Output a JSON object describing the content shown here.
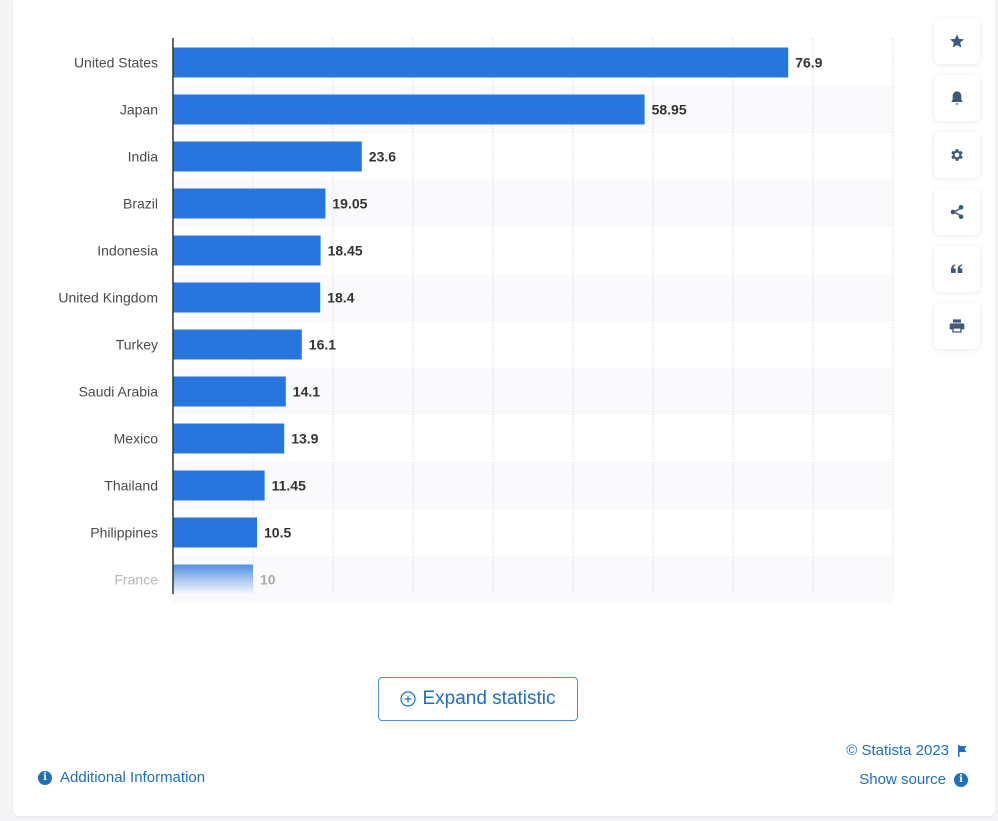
{
  "chart_data": {
    "type": "bar",
    "orientation": "horizontal",
    "title": "",
    "xlabel": "",
    "ylabel": "",
    "categories": [
      "United States",
      "Japan",
      "India",
      "Brazil",
      "Indonesia",
      "United Kingdom",
      "Turkey",
      "Saudi Arabia",
      "Mexico",
      "Thailand",
      "Philippines",
      "France"
    ],
    "values": [
      76.9,
      58.95,
      23.6,
      19.05,
      18.45,
      18.4,
      16.1,
      14.1,
      13.9,
      11.45,
      10.5,
      10
    ],
    "value_labels": [
      "76.9",
      "58.95",
      "23.6",
      "19.05",
      "18.45",
      "18.4",
      "16.1",
      "14.1",
      "13.9",
      "11.45",
      "10.5",
      "10"
    ],
    "xlim": [
      0,
      90
    ],
    "grid": true,
    "grid_step": 10,
    "faded_last_category": true,
    "bar_color": "#2876dd"
  },
  "side_tools": [
    {
      "name": "favorite",
      "icon": "star-icon"
    },
    {
      "name": "notification",
      "icon": "bell-icon"
    },
    {
      "name": "settings",
      "icon": "gear-icon"
    },
    {
      "name": "share",
      "icon": "share-icon"
    },
    {
      "name": "cite",
      "icon": "quote-icon"
    },
    {
      "name": "print",
      "icon": "printer-icon"
    }
  ],
  "expand_button": {
    "label": "Expand statistic",
    "icon": "plus-circle-icon"
  },
  "footer": {
    "additional_info": "Additional Information",
    "copyright": "© Statista 2023",
    "show_source": "Show source",
    "info_glyph": "i"
  },
  "colors": {
    "accent": "#1e6fc0",
    "bar": "#2876dd",
    "icon": "#3d5a80"
  }
}
